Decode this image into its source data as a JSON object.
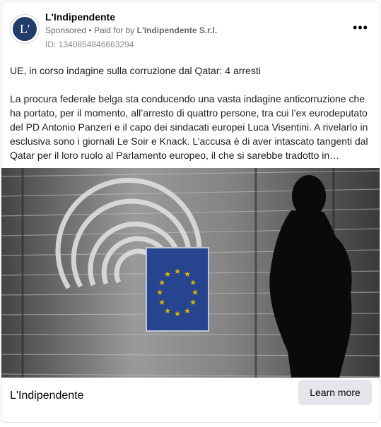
{
  "ad": {
    "page_name": "L'Indipendente",
    "logo_text": "L'",
    "sponsored_label": "Sponsored",
    "separator": "•",
    "paid_for_prefix": "Paid for by",
    "paid_for_entity": "L'Indipendente S.r.l.",
    "ad_id": "ID: 1340854846663294",
    "more_icon": "more-horizontal-icon",
    "more_label": "•••"
  },
  "post": {
    "headline": "UE, in corso indagine sulla corruzione dal Qatar: 4 arresti",
    "excerpt": "La procura federale belga sta conducendo una vasta indagine anticorruzione che ha portato, per il momento, all’arresto di quattro persone, tra cui l’ex eurodeputato del PD Antonio Panzeri e il capo dei sindacati europei Luca Visentini. A rivelarlo in esclusiva sono i giornali Le Soir e Knack. L’accusa è di aver intascato tangenti dal Qatar per il loro ruolo al Parlamento europeo, il che si sarebbe tradotto in ingerenze"
  },
  "image": {
    "description_icon": "eu-parliament-photo",
    "flag_color": "#2b4a9c",
    "star_color": "#f2c500"
  },
  "footer": {
    "source_name": "L'Indipendente",
    "cta_label": "Learn more"
  }
}
